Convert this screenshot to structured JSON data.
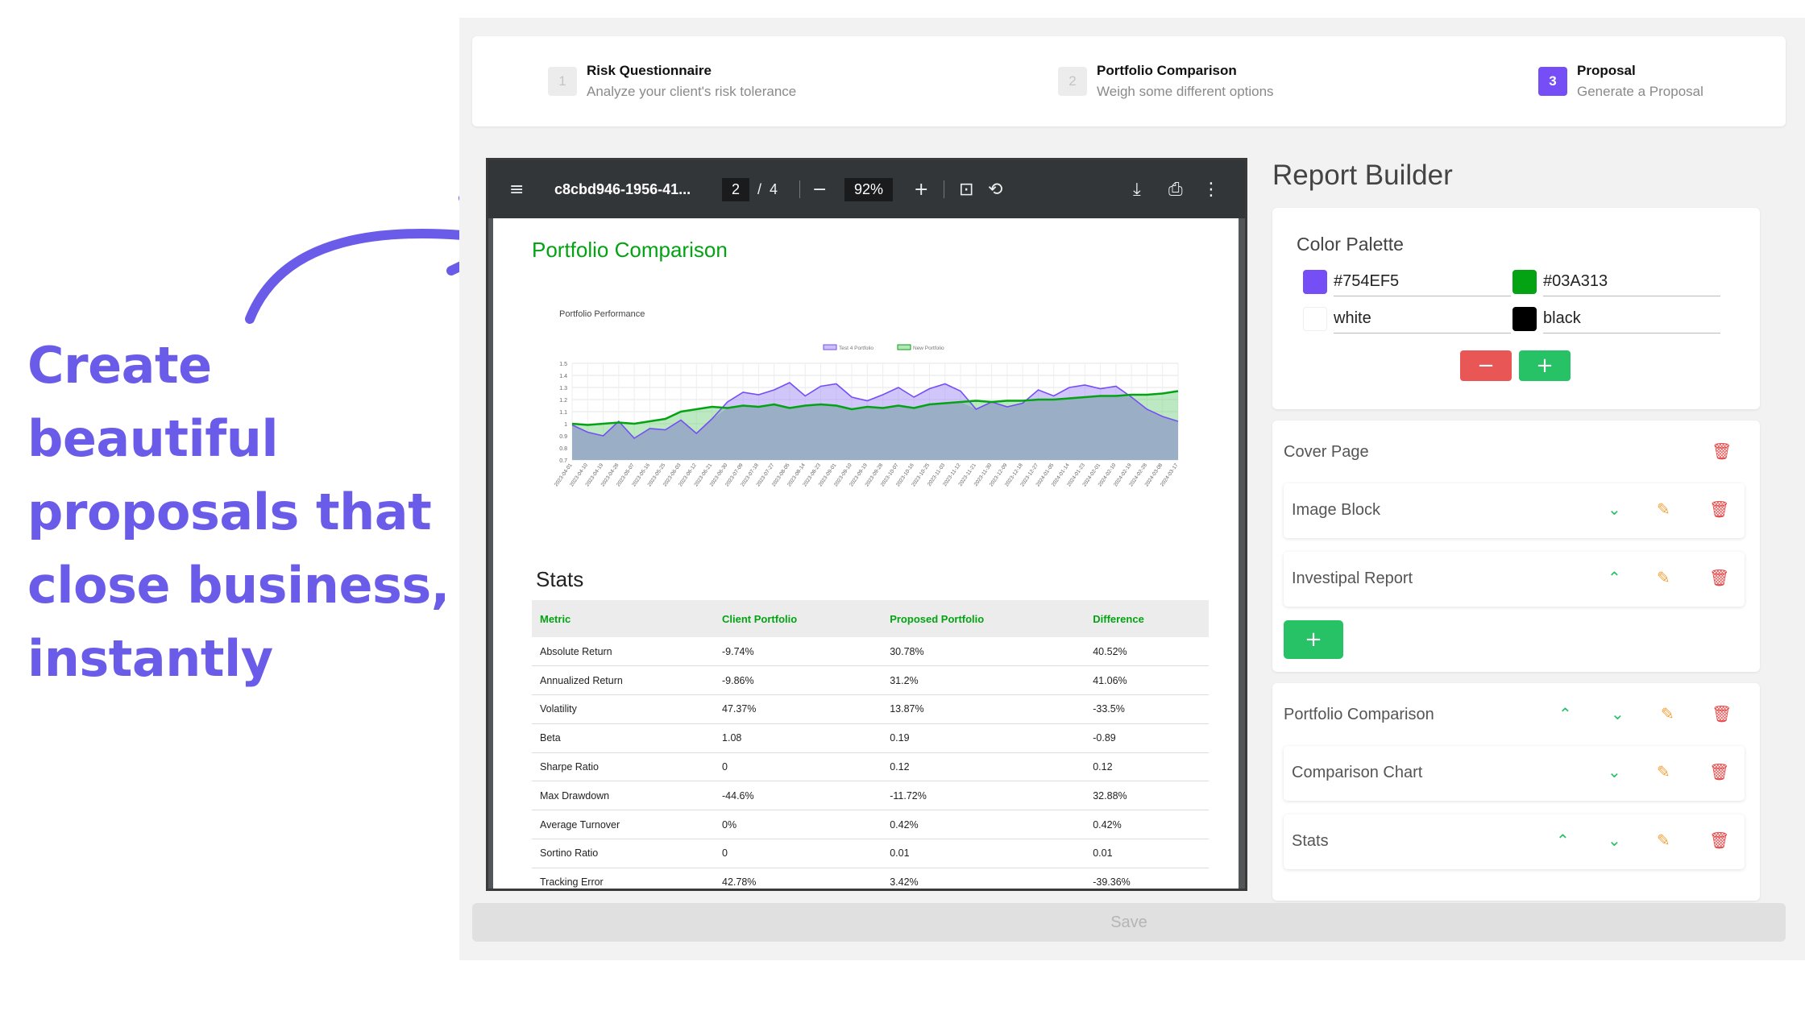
{
  "headline": [
    "Create beautiful",
    "proposals that",
    "close business,",
    "instantly"
  ],
  "steps": [
    {
      "num": "1",
      "title": "Risk Questionnaire",
      "subtitle": "Analyze your client's risk tolerance"
    },
    {
      "num": "2",
      "title": "Portfolio Comparison",
      "subtitle": "Weigh some different options"
    },
    {
      "num": "3",
      "title": "Proposal",
      "subtitle": "Generate a Proposal"
    }
  ],
  "viewer": {
    "filename": "c8cbd946-1956-41...",
    "page_current": "2",
    "page_sep": "/",
    "page_total": "4",
    "zoom": "92%"
  },
  "report": {
    "section_title": "Portfolio Comparison",
    "chart_title": "Portfolio Performance",
    "stats_title": "Stats",
    "stats_headers": [
      "Metric",
      "Client Portfolio",
      "Proposed Portfolio",
      "Difference"
    ],
    "stats_rows": [
      [
        "Absolute Return",
        "-9.74%",
        "30.78%",
        "40.52%"
      ],
      [
        "Annualized Return",
        "-9.86%",
        "31.2%",
        "41.06%"
      ],
      [
        "Volatility",
        "47.37%",
        "13.87%",
        "-33.5%"
      ],
      [
        "Beta",
        "1.08",
        "0.19",
        "-0.89"
      ],
      [
        "Sharpe Ratio",
        "0",
        "0.12",
        "0.12"
      ],
      [
        "Max Drawdown",
        "-44.6%",
        "-11.72%",
        "32.88%"
      ],
      [
        "Average Turnover",
        "0%",
        "0.42%",
        "0.42%"
      ],
      [
        "Sortino Ratio",
        "0",
        "0.01",
        "0.01"
      ],
      [
        "Tracking Error",
        "42.78%",
        "3.42%",
        "-39.36%"
      ]
    ]
  },
  "chart_data": {
    "type": "area",
    "title": "Portfolio Performance",
    "ylim": [
      0.7,
      1.5
    ],
    "yticks": [
      "0.7",
      "0.8",
      "0.9",
      "1",
      "1.1",
      "1.2",
      "1.3",
      "1.4",
      "1.5"
    ],
    "xlabels": [
      "2023-04-01",
      "2023-04-10",
      "2023-04-19",
      "2023-04-28",
      "2023-05-07",
      "2023-05-16",
      "2023-05-25",
      "2023-06-03",
      "2023-06-12",
      "2023-06-21",
      "2023-06-30",
      "2023-07-09",
      "2023-07-18",
      "2023-07-27",
      "2023-08-05",
      "2023-08-14",
      "2023-08-23",
      "2023-09-01",
      "2023-09-10",
      "2023-09-19",
      "2023-09-28",
      "2023-10-07",
      "2023-10-16",
      "2023-10-25",
      "2023-11-03",
      "2023-11-12",
      "2023-11-21",
      "2023-11-30",
      "2023-12-09",
      "2023-12-18",
      "2023-12-27",
      "2024-01-05",
      "2024-01-14",
      "2024-01-23",
      "2024-02-01",
      "2024-02-10",
      "2024-02-19",
      "2024-02-28",
      "2024-03-08",
      "2024-03-17"
    ],
    "series": [
      {
        "name": "Test 4 Portfolio",
        "color": "#754EF5",
        "values": [
          0.99,
          0.93,
          0.9,
          1.02,
          0.88,
          0.96,
          0.95,
          1.03,
          0.92,
          1.04,
          1.18,
          1.26,
          1.24,
          1.28,
          1.34,
          1.23,
          1.31,
          1.33,
          1.22,
          1.19,
          1.24,
          1.3,
          1.22,
          1.29,
          1.33,
          1.27,
          1.12,
          1.18,
          1.14,
          1.17,
          1.28,
          1.23,
          1.3,
          1.32,
          1.29,
          1.31,
          1.22,
          1.12,
          1.06,
          1.02
        ]
      },
      {
        "name": "New Portfolio",
        "color": "#03A313",
        "values": [
          1.0,
          0.99,
          1.0,
          1.01,
          1.0,
          1.02,
          1.04,
          1.1,
          1.12,
          1.14,
          1.13,
          1.15,
          1.14,
          1.16,
          1.13,
          1.15,
          1.16,
          1.15,
          1.12,
          1.14,
          1.13,
          1.15,
          1.13,
          1.16,
          1.17,
          1.18,
          1.19,
          1.18,
          1.19,
          1.19,
          1.2,
          1.2,
          1.21,
          1.22,
          1.23,
          1.23,
          1.24,
          1.24,
          1.25,
          1.27
        ]
      }
    ]
  },
  "report_builder": {
    "title": "Report Builder",
    "palette_title": "Color Palette",
    "palette": [
      {
        "label": "#754EF5",
        "color": "#754EF5"
      },
      {
        "label": "#03A313",
        "color": "#03A313"
      },
      {
        "label": "white",
        "color": "#ffffff"
      },
      {
        "label": "black",
        "color": "#000000"
      }
    ],
    "remove_color": "−",
    "add_color": "+",
    "cover_page": "Cover Page",
    "cover_blocks": [
      "Image Block",
      "Investipal Report"
    ],
    "add_block": "+",
    "comparison_section": "Portfolio Comparison",
    "comparison_blocks": [
      "Comparison Chart",
      "Stats"
    ]
  },
  "save_label": "Save"
}
